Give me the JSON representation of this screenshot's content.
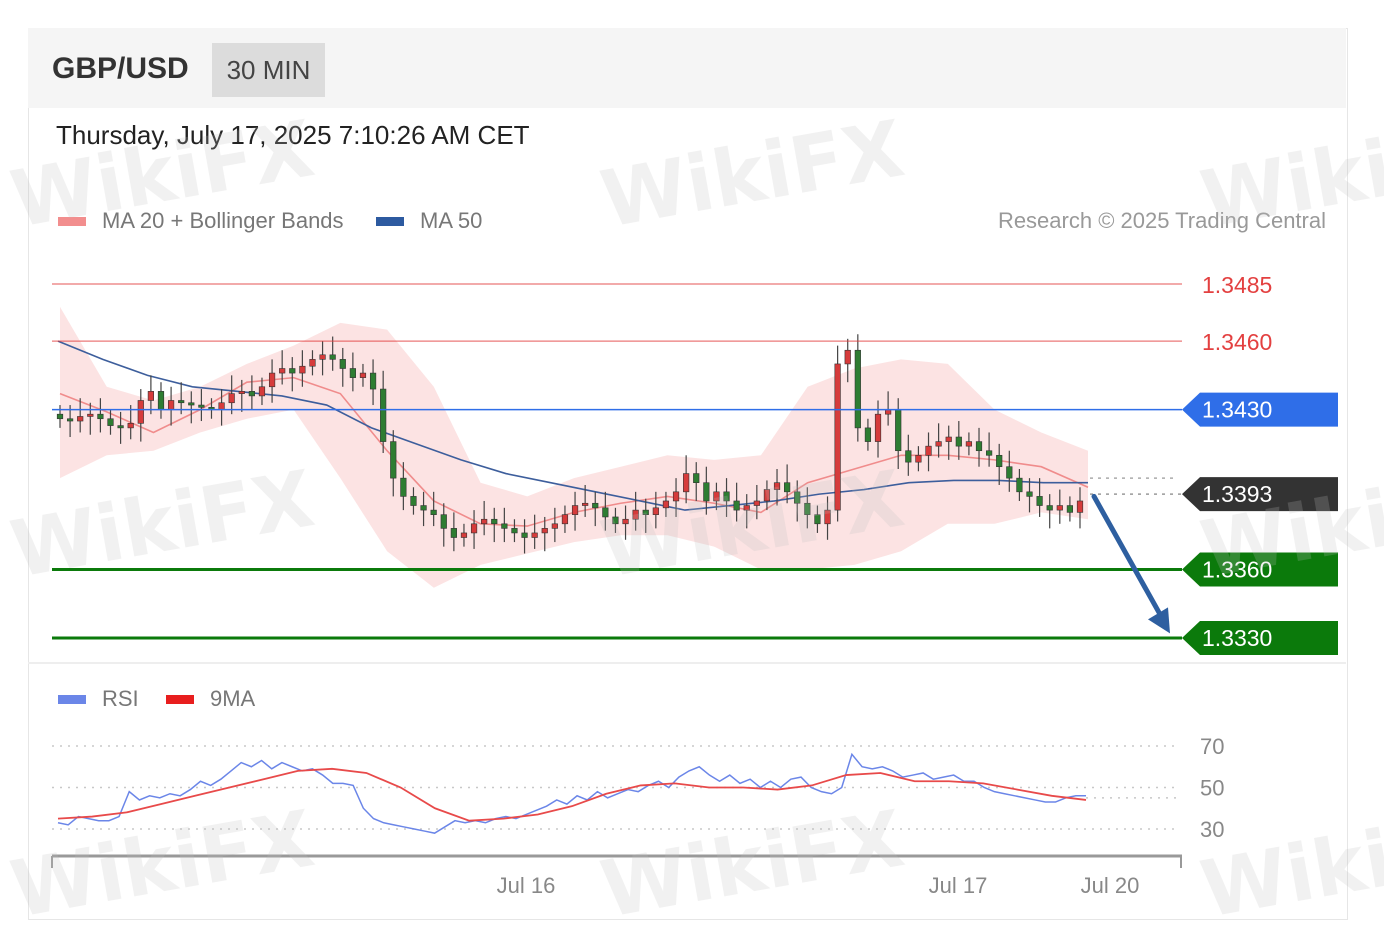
{
  "header": {
    "symbol": "GBP/USD",
    "timeframe": "30 MIN"
  },
  "timestamp": "Thursday, July 17, 2025 7:10:26 AM CET",
  "legend": {
    "ma20_label": "MA 20 + Bollinger Bands",
    "ma50_label": "MA 50",
    "credit": "Research © 2025 Trading Central"
  },
  "rsi_legend": {
    "rsi_label": "RSI",
    "ma9_label": "9MA"
  },
  "watermark": "WikiFX",
  "colors": {
    "ma20": "#f08c8c",
    "bollinger_fill": "#fbd9d9",
    "ma50": "#3d5e9c",
    "resistance": "#e34040",
    "pivot": "#2f6ee8",
    "current": "#333333",
    "support": "#0b7a0b",
    "arrow": "#2e5fa0",
    "rsi": "#6b86e8",
    "rsi_ma": "#e84a4a",
    "bull": "#d63b3b",
    "bear": "#2e7d32"
  },
  "chart_data": [
    {
      "type": "line",
      "title": "GBP/USD 30 MIN",
      "ylim": [
        1.3315,
        1.3515
      ],
      "x_ticks": [
        "Jul 16",
        "Jul 17",
        "Jul 20"
      ],
      "levels": [
        {
          "value": 1.3485,
          "label": "1.3485",
          "kind": "resistance"
        },
        {
          "value": 1.346,
          "label": "1.3460",
          "kind": "resistance"
        },
        {
          "value": 1.343,
          "label": "1.3430",
          "kind": "pivot"
        },
        {
          "value": 1.3393,
          "label": "1.3393",
          "kind": "current"
        },
        {
          "value": 1.336,
          "label": "1.3360",
          "kind": "support"
        },
        {
          "value": 1.333,
          "label": "1.3330",
          "kind": "support"
        }
      ],
      "forecast_arrow": {
        "from": 1.3392,
        "to": 1.3332
      },
      "close_series": [
        1.3426,
        1.3425,
        1.3427,
        1.3428,
        1.3426,
        1.3423,
        1.3422,
        1.3424,
        1.3434,
        1.3438,
        1.343,
        1.3434,
        1.3433,
        1.3432,
        1.3431,
        1.343,
        1.3433,
        1.3437,
        1.3438,
        1.3436,
        1.344,
        1.3446,
        1.3448,
        1.3446,
        1.3449,
        1.3452,
        1.3454,
        1.3452,
        1.3448,
        1.3444,
        1.3446,
        1.3439,
        1.3416,
        1.34,
        1.3392,
        1.3388,
        1.3386,
        1.3384,
        1.3378,
        1.3374,
        1.3376,
        1.338,
        1.3382,
        1.338,
        1.3378,
        1.3376,
        1.3374,
        1.3376,
        1.3378,
        1.338,
        1.3384,
        1.3388,
        1.3389,
        1.3387,
        1.3383,
        1.338,
        1.3382,
        1.3386,
        1.3384,
        1.3387,
        1.339,
        1.3394,
        1.3402,
        1.3398,
        1.339,
        1.3394,
        1.339,
        1.3386,
        1.3388,
        1.339,
        1.3395,
        1.3398,
        1.3394,
        1.3389,
        1.3384,
        1.338,
        1.3386,
        1.345,
        1.3456,
        1.3422,
        1.3416,
        1.3428,
        1.343,
        1.3412,
        1.3407,
        1.341,
        1.3414,
        1.3416,
        1.3418,
        1.3414,
        1.3416,
        1.3412,
        1.341,
        1.3405,
        1.34,
        1.3394,
        1.3392,
        1.3388,
        1.3386,
        1.3388,
        1.3385,
        1.339
      ],
      "bollinger": {
        "ma20": [
          1.3437,
          1.3429,
          1.342,
          1.343,
          1.3442,
          1.3444,
          1.3437,
          1.3412,
          1.339,
          1.338,
          1.3379,
          1.3385,
          1.3389,
          1.3392,
          1.3389,
          1.3385,
          1.3398,
          1.3404,
          1.341,
          1.341,
          1.3408,
          1.3405,
          1.3396
        ],
        "upper": [
          1.3475,
          1.344,
          1.3434,
          1.344,
          1.345,
          1.3458,
          1.3468,
          1.3465,
          1.344,
          1.3398,
          1.3392,
          1.34,
          1.3405,
          1.341,
          1.3408,
          1.341,
          1.344,
          1.3448,
          1.3452,
          1.345,
          1.343,
          1.342,
          1.3412
        ],
        "lower": [
          1.34,
          1.341,
          1.3412,
          1.342,
          1.3426,
          1.343,
          1.34,
          1.3368,
          1.3352,
          1.3362,
          1.3367,
          1.3372,
          1.3375,
          1.3375,
          1.337,
          1.336,
          1.336,
          1.3362,
          1.3368,
          1.338,
          1.338,
          1.3385,
          1.3382
        ]
      },
      "ma50": [
        1.346,
        1.3452,
        1.3445,
        1.344,
        1.3438,
        1.3436,
        1.3432,
        1.3422,
        1.3415,
        1.3408,
        1.3402,
        1.3398,
        1.3394,
        1.339,
        1.3386,
        1.3388,
        1.339,
        1.3393,
        1.3395,
        1.3398,
        1.3399,
        1.3399,
        1.3398,
        1.3398
      ]
    },
    {
      "type": "line",
      "title": "RSI",
      "ylim": [
        22,
        80
      ],
      "y_ticks": [
        70,
        50,
        30
      ],
      "series": [
        {
          "name": "RSI",
          "values": [
            33,
            32,
            36,
            35,
            34,
            34,
            36,
            48,
            44,
            46,
            45,
            47,
            46,
            49,
            53,
            51,
            54,
            58,
            62,
            60,
            63,
            59,
            62,
            60,
            58,
            59,
            56,
            52,
            52,
            51,
            40,
            35,
            33,
            32,
            31,
            30,
            29,
            28,
            31,
            34,
            33,
            34,
            33,
            35,
            36,
            35,
            37,
            39,
            41,
            44,
            42,
            46,
            44,
            48,
            45,
            47,
            49,
            48,
            51,
            53,
            50,
            55,
            58,
            60,
            56,
            53,
            56,
            52,
            54,
            50,
            53,
            50,
            54,
            55,
            50,
            48,
            47,
            50,
            66,
            60,
            59,
            60,
            58,
            55,
            56,
            57,
            54,
            55,
            56,
            53,
            53,
            50,
            48,
            47,
            46,
            45,
            44,
            43,
            43,
            45,
            46,
            46
          ]
        },
        {
          "name": "9MA",
          "values": [
            35,
            36,
            38,
            42,
            46,
            50,
            54,
            58,
            59,
            57,
            50,
            40,
            34,
            35,
            37,
            41,
            47,
            51,
            52,
            50,
            50,
            49,
            51,
            56,
            57,
            53,
            53,
            52,
            49,
            46,
            44
          ]
        }
      ]
    }
  ]
}
